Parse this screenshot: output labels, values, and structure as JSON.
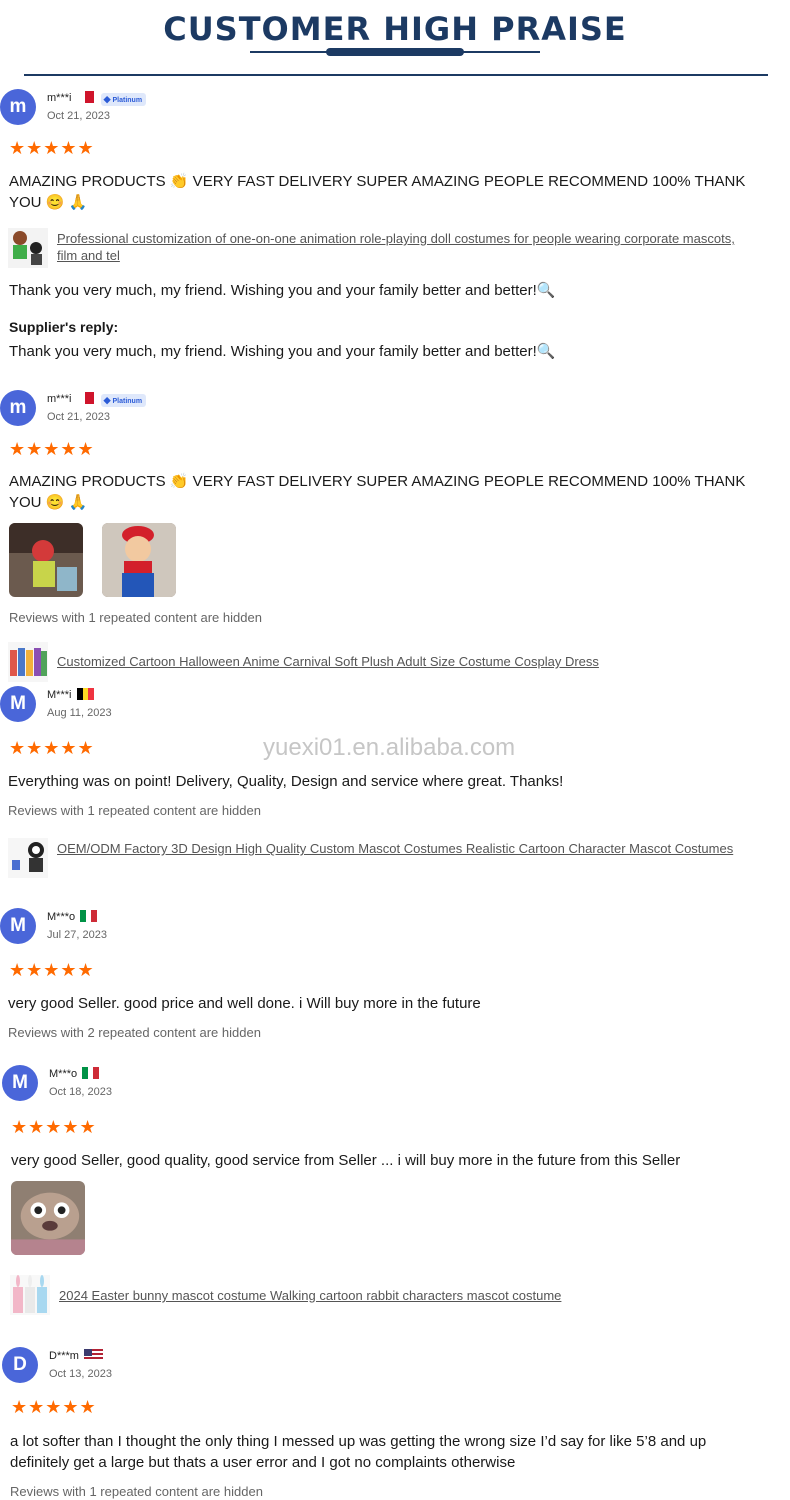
{
  "header": {
    "title": "CUSTOMER HIGH PRAISE"
  },
  "watermark": "yuexi01.en.alibaba.com",
  "icons": {
    "star": "★★★★★",
    "verified": "◆"
  },
  "reviews": [
    {
      "avatar_letter": "m",
      "user": "m***i",
      "flag": "malta",
      "badge": "Platinum",
      "date": "Oct 21, 2023",
      "rating": 5,
      "text": "AMAZING PRODUCTS 👏 VERY FAST DELIVERY SUPER AMAZING PEOPLE RECOMMEND 100% THANK YOU 😊 🙏",
      "product": "Professional customization of one-on-one animation role-playing doll costumes for people wearing corporate mascots, film and tel",
      "extra_text": "Thank you very much, my friend. Wishing you and your family better and better!🔍",
      "reply_label": "Supplier's reply:",
      "reply": "Thank you very much, my friend. Wishing you and your family better and better!🔍"
    },
    {
      "avatar_letter": "m",
      "user": "m***i",
      "flag": "malta",
      "badge": "Platinum",
      "date": "Oct 21, 2023",
      "rating": 5,
      "text": "AMAZING PRODUCTS 👏 VERY FAST DELIVERY SUPER AMAZING PEOPLE RECOMMEND 100% THANK YOU 😊 🙏",
      "photos": [
        "costume-photo-1",
        "costume-photo-2"
      ],
      "hidden_note": "Reviews with 1 repeated content are hidden",
      "product": "Customized Cartoon Halloween Anime Carnival Soft Plush Adult Size Costume Cosplay Dress"
    },
    {
      "avatar_letter": "M",
      "user": "M***i",
      "flag": "belgium",
      "date": "Aug 11, 2023",
      "rating": 5,
      "text": "Everything was on point! Delivery, Quality, Design and service where great. Thanks!",
      "hidden_note": "Reviews with 1 repeated content are hidden",
      "product": "OEM/ODM Factory 3D Design High Quality Custom Mascot Costumes Realistic Cartoon Character Mascot Costumes"
    },
    {
      "avatar_letter": "M",
      "user": "M***o",
      "flag": "italy",
      "date": "Jul 27, 2023",
      "rating": 5,
      "text": "very good Seller. good price and well done. i Will buy more in the future",
      "hidden_note": "Reviews with 2 repeated content are hidden"
    },
    {
      "avatar_letter": "M",
      "user": "M***o",
      "flag": "italy",
      "date": "Oct 18, 2023",
      "rating": 5,
      "text": "very good Seller, good quality, good service from Seller ... i will buy more in the future from this Seller",
      "photos": [
        "mascot-head-photo"
      ],
      "product": "2024 Easter bunny mascot costume Walking cartoon rabbit characters mascot costume"
    },
    {
      "avatar_letter": "D",
      "user": "D***m",
      "flag": "usa",
      "date": "Oct 13, 2023",
      "rating": 5,
      "text": "a lot softer than I thought the only thing I messed up was getting the wrong size I’d say for like 5’8 and up definitely get a large but thats a user error and I got no complaints otherwise",
      "hidden_note": "Reviews with 1 repeated content are hidden"
    }
  ]
}
